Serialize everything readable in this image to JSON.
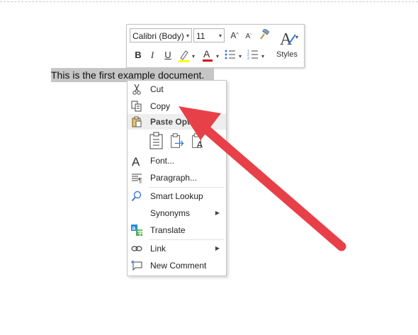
{
  "document": {
    "text": "This is the first example document."
  },
  "mini_toolbar": {
    "font_name": "Calibri (Body)",
    "font_size": "11",
    "styles_label": "Styles",
    "highlight_color": "#ffff00",
    "font_color": "#d0101a"
  },
  "context_menu": {
    "cut": "Cut",
    "copy": "Copy",
    "paste_options": "Paste Options:",
    "font": "Font...",
    "paragraph": "Paragraph...",
    "smart_lookup": "Smart Lookup",
    "synonyms": "Synonyms",
    "translate": "Translate",
    "link": "Link",
    "new_comment": "New Comment"
  },
  "annotation": {
    "arrow_color": "#e84048"
  }
}
